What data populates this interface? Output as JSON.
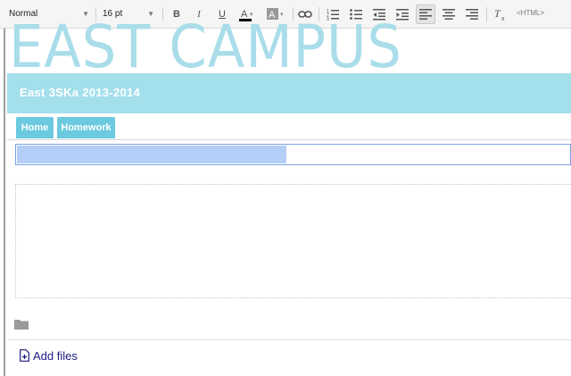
{
  "toolbar": {
    "style_select": "Normal",
    "size_select": "16 pt",
    "bold": "B",
    "italic": "I",
    "underline": "U",
    "html_label": "<HTML>",
    "text_color": "#000000"
  },
  "site": {
    "title": "EAST CAMPUS",
    "subtitle": "East 3SKa 2013-2014"
  },
  "tabs": [
    {
      "label": "Home"
    },
    {
      "label": "Homework"
    }
  ],
  "page_title_input": {
    "value": ""
  },
  "attachments": {
    "add_files_label": "Add files"
  },
  "colors": {
    "banner": "#a4dfec",
    "title_text": "#a9dde9",
    "tab": "#6bcadf",
    "selection": "#b3cff7"
  }
}
